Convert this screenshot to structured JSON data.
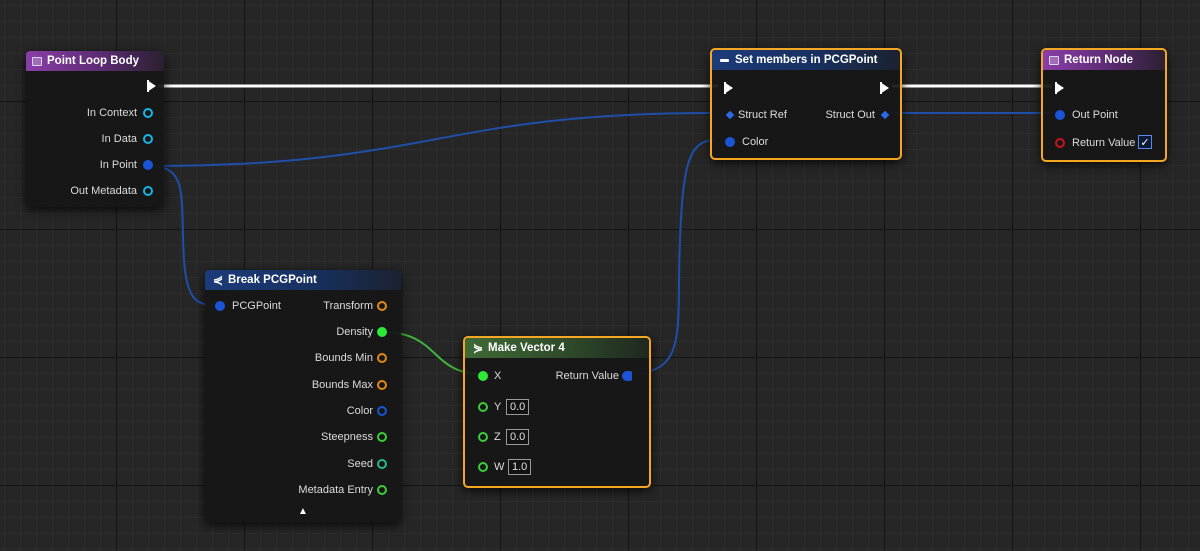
{
  "colors": {
    "exec_wire": "#ffffff",
    "struct_wire": "#1f4fa8",
    "float_wire": "#3fb43f",
    "selection_outline": "#f5a623",
    "header_event": "#8a3ea8",
    "header_struct": "#1c3b7a",
    "header_pure": "#3f6a35"
  },
  "nodes": {
    "point_loop_body": {
      "title": "Point Loop Body",
      "icon": "function-icon",
      "outputs": [
        "In Context",
        "In Data",
        "In Point",
        "Out Metadata"
      ]
    },
    "set_members": {
      "title": "Set members in PCGPoint",
      "icon": "set-members-icon",
      "inputs": [
        "Struct Ref",
        "Color"
      ],
      "outputs": [
        "Struct Out"
      ]
    },
    "return_node": {
      "title": "Return Node",
      "icon": "function-icon",
      "inputs": [
        "Out Point",
        "Return Value"
      ],
      "return_value_checked": true,
      "check_glyph": "✓"
    },
    "break_pcgpoint": {
      "title": "Break PCGPoint",
      "icon": "break-struct-icon",
      "inputs": [
        "PCGPoint"
      ],
      "outputs": [
        "Transform",
        "Density",
        "Bounds Min",
        "Bounds Max",
        "Color",
        "Steepness",
        "Seed",
        "Metadata Entry"
      ],
      "collapse_glyph": "▲"
    },
    "make_vector4": {
      "title": "Make Vector 4",
      "icon": "make-struct-icon",
      "inputs": [
        "X",
        "Y",
        "Z",
        "W"
      ],
      "input_values": {
        "Y": "0.0",
        "Z": "0.0",
        "W": "1.0"
      },
      "outputs": [
        "Return Value"
      ]
    }
  }
}
